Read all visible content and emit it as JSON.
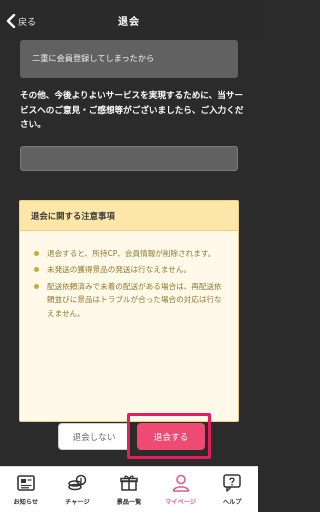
{
  "header": {
    "back_label": "戻る",
    "title": "退会"
  },
  "form": {
    "selected_reason": "二重に会員登録してしまったから",
    "comment_prompt": "その他、今後よりよいサービスを実現するために、当サービスへのご意見・ご感想等がございましたら、ご入力ください。",
    "comment_value": ""
  },
  "notice": {
    "title": "退会に関する注意事項",
    "items": [
      "退会すると、所持CP、会員情報が削除されます。",
      "未発送の獲得景品の発送は行なえません。",
      "配送依頼済みで未着の配送がある場合は、再配送依頼並びに景品はトラブルが合った場合の対応は行なえません。"
    ]
  },
  "buttons": {
    "cancel_label": "退会しない",
    "withdraw_label": "退会する"
  },
  "tabs": [
    {
      "label": "お知らせ",
      "icon": "news-icon",
      "active": false
    },
    {
      "label": "チャージ",
      "icon": "coins-icon",
      "active": false
    },
    {
      "label": "景品一覧",
      "icon": "prize-list-icon",
      "active": false
    },
    {
      "label": "マイページ",
      "icon": "user-icon",
      "active": true
    },
    {
      "label": "ヘルプ",
      "icon": "help-icon",
      "active": false
    }
  ],
  "colors": {
    "accent": "#ee4a73",
    "highlight_frame": "#e51d5d",
    "notice_bg": "#fff9ea",
    "notice_header": "#fde7a8",
    "notice_text": "#8c7a2c",
    "active_tab": "#d95f8a"
  }
}
